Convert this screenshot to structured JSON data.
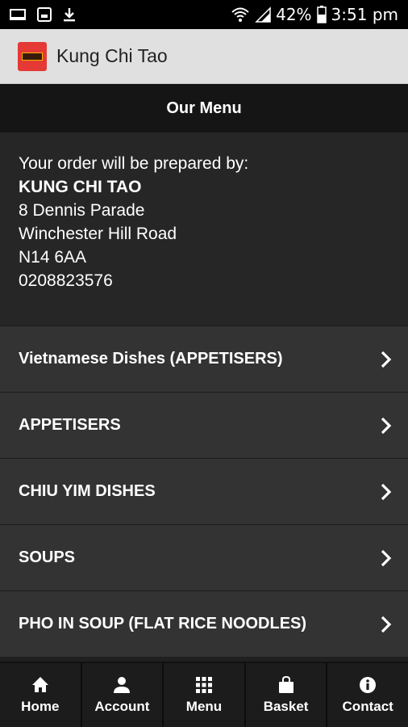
{
  "status_bar": {
    "battery": "42%",
    "time": "3:51 pm",
    "icons": [
      "screen-icon",
      "image-icon",
      "download-icon",
      "wifi-icon",
      "signal-icon",
      "battery-icon"
    ]
  },
  "app_bar": {
    "title": "Kung Chi Tao",
    "logo_color": "#e53935"
  },
  "header": {
    "title": "Our Menu"
  },
  "info": {
    "intro": "Your order will be prepared by:",
    "restaurant_name": "KUNG CHI TAO",
    "address_line1": "8 Dennis Parade",
    "address_line2": "Winchester Hill Road",
    "postcode": "N14 6AA",
    "phone": "0208823576"
  },
  "categories": [
    {
      "label": "Vietnamese Dishes (APPETISERS)"
    },
    {
      "label": "APPETISERS"
    },
    {
      "label": "CHIU YIM DISHES"
    },
    {
      "label": "SOUPS"
    },
    {
      "label": "PHO IN SOUP (FLAT RICE NOODLES)"
    }
  ],
  "bottom_nav": [
    {
      "label": "Home",
      "icon": "home-icon"
    },
    {
      "label": "Account",
      "icon": "user-icon"
    },
    {
      "label": "Menu",
      "icon": "grid-icon"
    },
    {
      "label": "Basket",
      "icon": "bag-icon"
    },
    {
      "label": "Contact",
      "icon": "info-icon"
    }
  ]
}
